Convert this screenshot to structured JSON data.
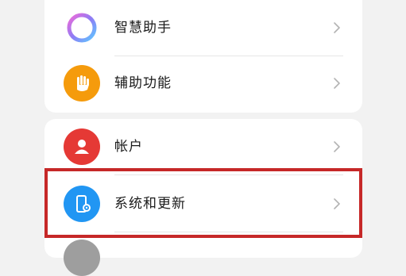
{
  "settings": {
    "items": [
      {
        "label": "智慧助手",
        "icon": "assistant-ring-icon",
        "icon_color": "#8e7cf5"
      },
      {
        "label": "辅助功能",
        "icon": "hand-icon",
        "icon_color": "#f59b0c"
      },
      {
        "label": "帐户",
        "icon": "account-icon",
        "icon_color": "#e53935"
      },
      {
        "label": "系统和更新",
        "icon": "system-update-icon",
        "icon_color": "#2196f3"
      }
    ]
  },
  "highlight_color": "#c62828"
}
